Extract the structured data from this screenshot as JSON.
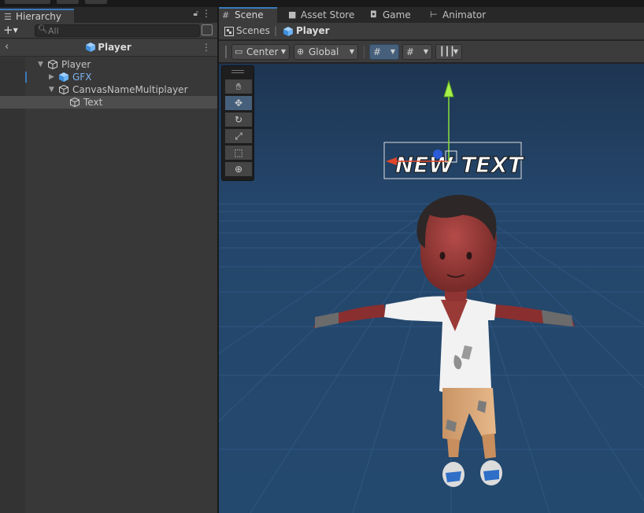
{
  "hierarchy": {
    "tab_label": "Hierarchy",
    "tab_icon": "list-icon",
    "add_label": "+",
    "search_placeholder": "All",
    "prefab_title": "Player",
    "tree": [
      {
        "label": "Player",
        "indent": 0,
        "expanded": true,
        "prefab": false
      },
      {
        "label": "GFX",
        "indent": 1,
        "expanded": false,
        "prefab": true
      },
      {
        "label": "CanvasNameMultiplayer",
        "indent": 1,
        "expanded": true,
        "prefab": false
      },
      {
        "label": "Text",
        "indent": 2,
        "selected": true,
        "prefab": false
      }
    ]
  },
  "scene": {
    "tabs": [
      {
        "label": "Scene",
        "icon": "grid-icon",
        "active": true
      },
      {
        "label": "Asset Store",
        "icon": "bag-icon"
      },
      {
        "label": "Game",
        "icon": "gamepad-icon"
      },
      {
        "label": "Animator",
        "icon": "animator-icon"
      }
    ],
    "breadcrumb": {
      "root": "Scenes",
      "current": "Player"
    },
    "toolbar": {
      "pivot_label": "Center",
      "space_label": "Global"
    },
    "tools": [
      "hand-tool",
      "move-tool",
      "rotate-tool",
      "scale-tool",
      "rect-tool",
      "transform-tool"
    ],
    "active_tool": "move-tool",
    "world_text": "NEW TEXT"
  },
  "colors": {
    "accent": "#3a79bb",
    "prefab": "#7bb3f0",
    "sky": "#24486e"
  }
}
